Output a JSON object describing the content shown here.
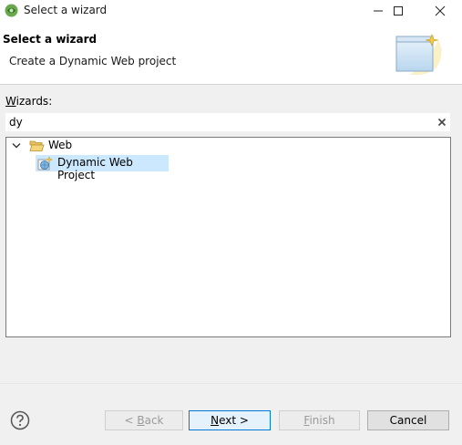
{
  "window": {
    "title": "Select a wizard"
  },
  "banner": {
    "title": "Select a wizard",
    "description": "Create a Dynamic Web project"
  },
  "wizards": {
    "label_mnemonic": "W",
    "label_rest": "izards:",
    "filter_value": "dy",
    "tree": {
      "category": {
        "label": "Web",
        "expanded": true
      },
      "items": [
        {
          "label": "Dynamic Web Project",
          "selected": true
        }
      ]
    }
  },
  "buttons": {
    "back": {
      "prefix": "< ",
      "mnemonic": "B",
      "rest": "ack"
    },
    "next": {
      "mnemonic": "N",
      "rest": "ext >"
    },
    "finish": {
      "mnemonic": "F",
      "rest": "inish"
    },
    "cancel": {
      "label": "Cancel"
    }
  },
  "colors": {
    "selection": "#cce8ff",
    "default_button_border": "#0078d7"
  }
}
